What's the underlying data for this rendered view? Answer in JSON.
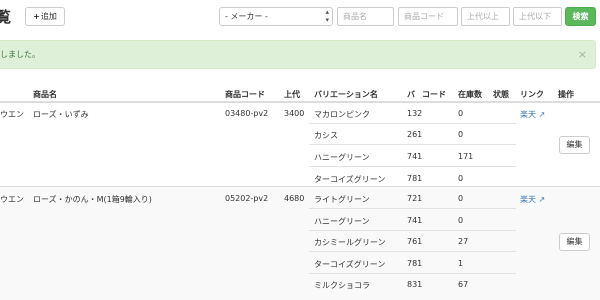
{
  "header": {
    "title": "覧",
    "add_label": "追加"
  },
  "search": {
    "maker_selected": "- メーカー -",
    "product_name_placeholder": "商品名",
    "product_code_placeholder": "商品コード",
    "price_min_placeholder": "上代以上",
    "price_max_placeholder": "上代以下",
    "search_label": "検索"
  },
  "alert": {
    "message": "しました。",
    "close": "×"
  },
  "table": {
    "columns": [
      "商品名",
      "商品コード",
      "上代",
      "バリエーション名",
      "バ",
      "コード",
      "在庫数",
      "状態",
      "リンク",
      "操作"
    ],
    "groups": [
      {
        "maker": "ウエン",
        "name": "ローズ・いずみ",
        "code": "03480-pv2",
        "price": "3400",
        "link": "楽天",
        "edit": "編集",
        "variations": [
          {
            "name": "マカロンピンク",
            "code": "132",
            "stock": "0"
          },
          {
            "name": "カシス",
            "code": "261",
            "stock": "0"
          },
          {
            "name": "ハニーグリーン",
            "code": "741",
            "stock": "171"
          },
          {
            "name": "ターコイズグリーン",
            "code": "781",
            "stock": "0"
          }
        ]
      },
      {
        "maker": "ウエン",
        "name": "ローズ・かのん・M(1箱9輪入り)",
        "code": "05202-pv2",
        "price": "4680",
        "link": "楽天",
        "edit": "編集",
        "variations": [
          {
            "name": "ライトグリーン",
            "code": "721",
            "stock": "0"
          },
          {
            "name": "ハニーグリーン",
            "code": "741",
            "stock": "0"
          },
          {
            "name": "カシミールグリーン",
            "code": "761",
            "stock": "27"
          },
          {
            "name": "ターコイズグリーン",
            "code": "781",
            "stock": "1"
          },
          {
            "name": "ミルクショコラ",
            "code": "831",
            "stock": "67"
          }
        ]
      }
    ]
  }
}
